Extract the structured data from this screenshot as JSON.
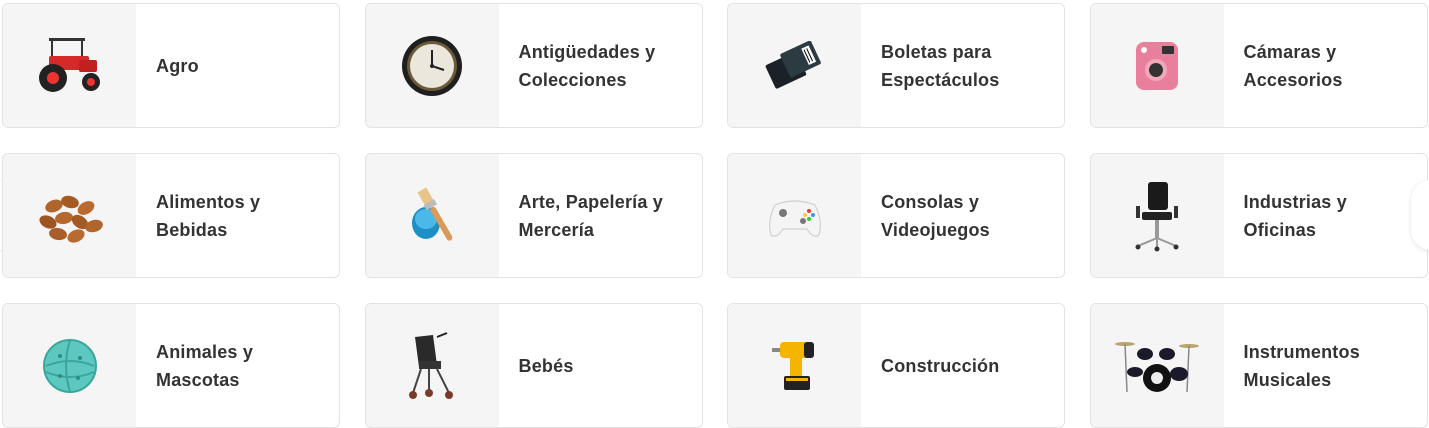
{
  "categories": [
    {
      "label": "Agro",
      "icon": "tractor-icon"
    },
    {
      "label": "Antigüedades y\nColecciones",
      "icon": "wall-clock-icon"
    },
    {
      "label": "Boletas para\nEspectáculos",
      "icon": "tickets-icon"
    },
    {
      "label": "Cámaras y\nAccesorios",
      "icon": "instant-camera-icon"
    },
    {
      "label": "Alimentos y\nBebidas",
      "icon": "almonds-icon"
    },
    {
      "label": "Arte, Papelería y\nMercería",
      "icon": "paintbrush-icon"
    },
    {
      "label": "Consolas y\nVideojuegos",
      "icon": "game-controller-icon"
    },
    {
      "label": "Industrias y\nOficinas",
      "icon": "office-chair-icon"
    },
    {
      "label": "Animales y\nMascotas",
      "icon": "pet-ball-icon"
    },
    {
      "label": "Bebés",
      "icon": "stroller-icon"
    },
    {
      "label": "Construcción",
      "icon": "drill-icon"
    },
    {
      "label": "Instrumentos\nMusicales",
      "icon": "drum-kit-icon"
    }
  ],
  "colors": {
    "thumb_bg": "#f5f5f5",
    "border": "#e3e3e3",
    "text": "#333333"
  }
}
